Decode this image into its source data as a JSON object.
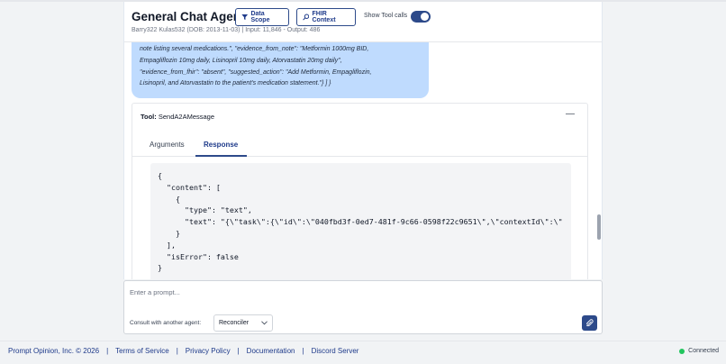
{
  "header": {
    "title": "General Chat Agent",
    "subtitle": "Barry322 Kulas532 (DOB: 2013-11-03) | Input: 11,846 - Output: 486",
    "data_scope_label": "Data Scope",
    "fhir_context_label": "FHIR Context",
    "show_tool_calls_label": "Show Tool calls",
    "show_tool_calls_on": true,
    "icons": {
      "data_scope": "filter-icon",
      "fhir_context": "search-icon"
    }
  },
  "message": {
    "lines": [
      "note listing several medications.\", \"evidence_from_note\": \"Metformin 1000mg BID,",
      "Empagliflozin 10mg daily, Lisinopril 10mg daily, Atorvastatin 20mg daily\",",
      "\"evidence_from_fhir\": \"absent\", \"suggested_action\": \"Add Metformin, Empagliflozin,",
      "Lisinopril, and Atorvastatin to the patient's medication statement.\"} ] }"
    ]
  },
  "tool": {
    "label": "Tool:",
    "name": "SendA2AMessage",
    "collapse_label": "—",
    "tabs": [
      {
        "label": "Arguments",
        "active": false
      },
      {
        "label": "Response",
        "active": true
      }
    ],
    "response_code": "{\n  \"content\": [\n    {\n      \"type\": \"text\",\n      \"text\": \"{\\\"task\\\":{\\\"id\\\":\\\"040fbd3f-0ed7-481f-9c66-0598f22c9651\\\",\\\"contextId\\\":\\\"\n    }\n  ],\n  \"isError\": false\n}"
  },
  "prompt": {
    "placeholder": "Enter a prompt...",
    "value": "",
    "consult_label": "Consult with another agent:",
    "agent_selected": "Reconciler",
    "attach_icon": "paperclip-icon"
  },
  "footer": {
    "copyright": "Prompt Opinion, Inc. © 2026",
    "separator": "|",
    "links": [
      "Terms of Service",
      "Privacy Policy",
      "Documentation",
      "Discord Server"
    ],
    "status": "Connected",
    "status_color": "#22c55e"
  },
  "colors": {
    "accent": "#2d4a8a",
    "bubble": "#bfdbfe"
  }
}
